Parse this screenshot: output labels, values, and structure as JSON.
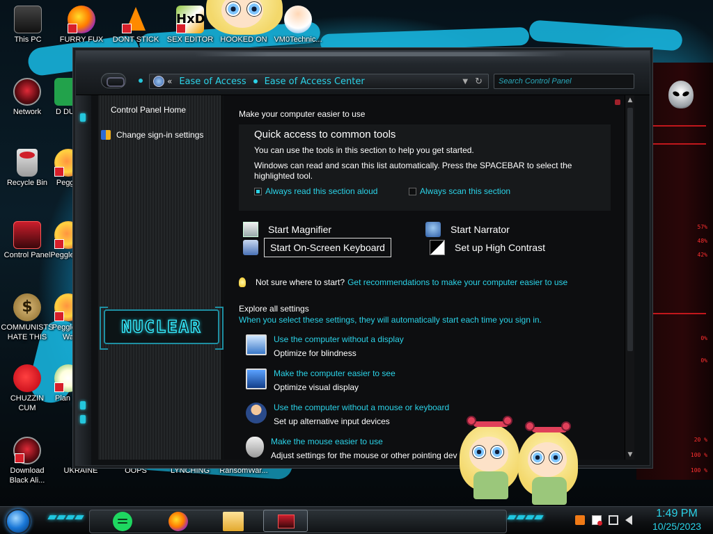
{
  "desktop": {
    "icons": [
      {
        "label": "This PC"
      },
      {
        "label": "FURRY FUX"
      },
      {
        "label": "DONT STICK"
      },
      {
        "label": "SEX EDITOR"
      },
      {
        "label": "HOOKED ON"
      },
      {
        "label": "VM0Technic..."
      },
      {
        "label": "Network"
      },
      {
        "label": "D DUM"
      },
      {
        "label": "Recycle Bin"
      },
      {
        "label": "Peggle"
      },
      {
        "label": "Control Panel"
      },
      {
        "label": "Peggle De"
      },
      {
        "label": "COMMUNISTS HATE THIS G..."
      },
      {
        "label": "Peggle of Wa"
      },
      {
        "label": "CHUZZIN CUM"
      },
      {
        "label": "Plan Zo"
      },
      {
        "label": "Download Black Ali..."
      },
      {
        "label": "UKRAINE"
      },
      {
        "label": "OOPS"
      },
      {
        "label": "LYNCHING"
      },
      {
        "label": "RansomWar..."
      }
    ]
  },
  "window": {
    "address": {
      "crumbs": [
        "Ease of Access",
        "Ease of Access Center"
      ],
      "chevron": "«"
    },
    "search": {
      "placeholder": "Search Control Panel"
    },
    "sidebar": {
      "links": [
        {
          "label": "Control Panel Home"
        },
        {
          "label": "Change sign-in settings"
        }
      ],
      "logo_text": "NUCLEAR"
    },
    "main": {
      "title": "Make your computer easier to use",
      "quick_access": {
        "heading": "Quick access to common tools",
        "line1": "You can use the tools in this section to help you get started.",
        "line2": "Windows can read and scan this list automatically.  Press the SPACEBAR to select the highlighted tool.",
        "read_aloud": {
          "label": "Always read this section aloud",
          "checked": true
        },
        "scan": {
          "label": "Always scan this section",
          "checked": false
        }
      },
      "tools": [
        {
          "label": "Start Magnifier",
          "icon": "magnifier-icon"
        },
        {
          "label": "Start Narrator",
          "icon": "narrator-icon"
        },
        {
          "label": "Start On-Screen Keyboard",
          "icon": "keyboard-icon"
        },
        {
          "label": "Set up High Contrast",
          "icon": "high-contrast-icon"
        }
      ],
      "hint": {
        "question": "Not sure where to start?",
        "link": "Get recommendations to make your computer easier to use"
      },
      "explore": {
        "heading": "Explore all settings",
        "subheading": "When you select these settings, they will automatically start each time you sign in.",
        "items": [
          {
            "link": "Use the computer without a display",
            "desc": "Optimize for blindness",
            "icon": "monitor-icon"
          },
          {
            "link": "Make the computer easier to see",
            "desc": "Optimize visual display",
            "icon": "display-icon"
          },
          {
            "link": "Use the computer without a mouse or keyboard",
            "desc": "Set up alternative input devices",
            "icon": "person-icon"
          },
          {
            "link": "Make the mouse easier to use",
            "desc": "Adjust settings for the mouse or other pointing dev",
            "icon": "mouse-icon"
          }
        ]
      }
    }
  },
  "hud": {
    "readouts": [
      "57%",
      "48%",
      "42%",
      "0%",
      "0%",
      "20 %",
      "100 %",
      "100 %"
    ]
  },
  "taskbar": {
    "clock": {
      "time": "1:49 PM",
      "date": "10/25/2023"
    }
  },
  "colors": {
    "accent": "#2bd3e8",
    "window_bg": "#0d0e10",
    "hud_red": "#ff3030"
  }
}
